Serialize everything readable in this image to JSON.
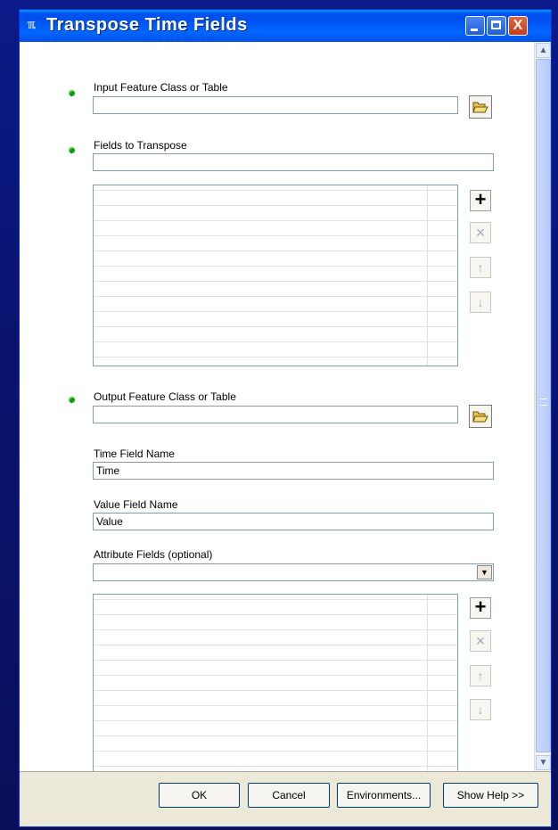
{
  "window": {
    "title": "Transpose Time Fields",
    "icon": "tool-icon",
    "controls": {
      "minimize": "_",
      "maximize": "□",
      "close": "X"
    }
  },
  "form": {
    "input_feature": {
      "label": "Input Feature Class or Table",
      "value": ""
    },
    "fields_to_transpose": {
      "label": "Fields to Transpose",
      "value": ""
    },
    "output_feature": {
      "label": "Output Feature Class or Table",
      "value": ""
    },
    "time_field": {
      "label": "Time Field Name",
      "value": "Time"
    },
    "value_field": {
      "label": "Value Field Name",
      "value": "Value"
    },
    "attribute_fields": {
      "label": "Attribute Fields (optional)",
      "value": ""
    }
  },
  "list_actions": {
    "add": "+",
    "remove": "×",
    "up": "↑",
    "down": "↓"
  },
  "footer": {
    "ok": "OK",
    "cancel": "Cancel",
    "environments": "Environments...",
    "show_help": "Show Help >>"
  },
  "colors": {
    "required_bullet": "#0c9e0c",
    "title_bar": "#0050ee",
    "close_button": "#c73b1a"
  }
}
